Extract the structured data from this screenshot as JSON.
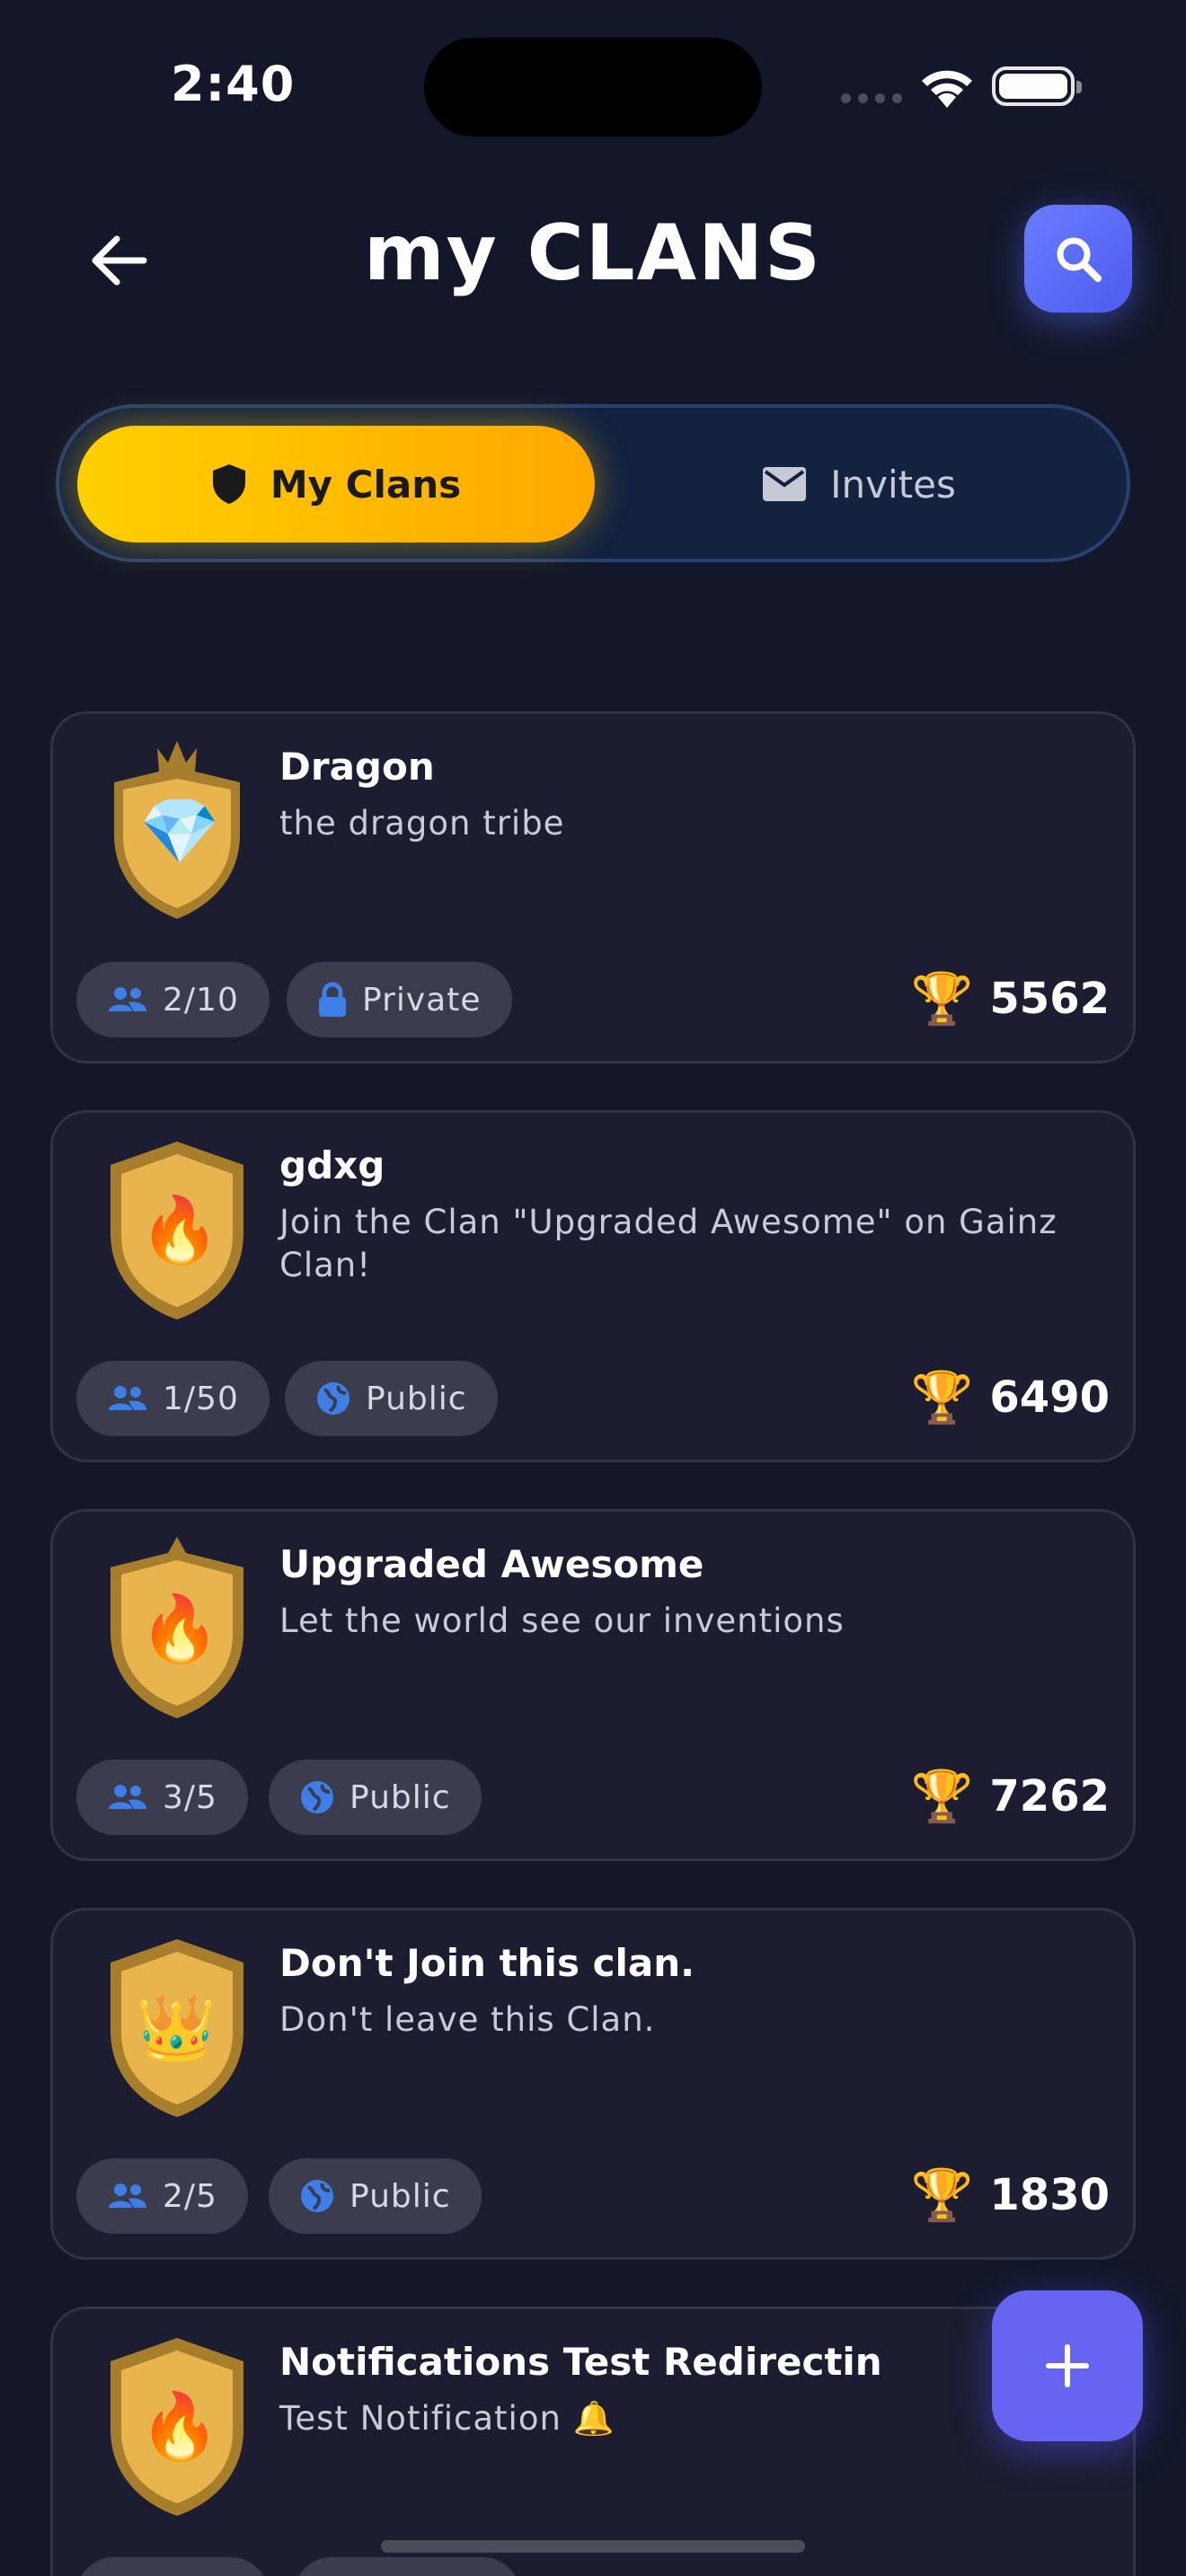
{
  "status_bar": {
    "time": "2:40"
  },
  "header": {
    "title": "my CLANS",
    "back_icon": "arrow-left-icon",
    "search_icon": "search-icon"
  },
  "tabs": [
    {
      "label": "My Clans",
      "icon": "shield-icon",
      "active": true
    },
    {
      "label": "Invites",
      "icon": "mail-icon",
      "active": false
    }
  ],
  "clans": [
    {
      "name": "Dragon",
      "description": "the dragon tribe",
      "members": "2/10",
      "privacy": "Private",
      "privacy_icon": "lock-icon",
      "trophies": "5562",
      "emblem": "💎"
    },
    {
      "name": "gdxg",
      "description": "Join the Clan \"Upgraded Awesome\" on Gainz Clan!",
      "members": "1/50",
      "privacy": "Public",
      "privacy_icon": "globe-icon",
      "trophies": "6490",
      "emblem": "🔥"
    },
    {
      "name": "Upgraded Awesome",
      "description": "Let the world see our inventions",
      "members": "3/5",
      "privacy": "Public",
      "privacy_icon": "globe-icon",
      "trophies": "7262",
      "emblem": "🔥"
    },
    {
      "name": "Don't Join this clan.",
      "description": "Don't leave this Clan.",
      "members": "2/5",
      "privacy": "Public",
      "privacy_icon": "globe-icon",
      "trophies": "1830",
      "emblem": "👑"
    },
    {
      "name": "Notifications Test Redirectin",
      "description": "Test Notification 🔔",
      "members": "",
      "privacy": "",
      "privacy_icon": "globe-icon",
      "trophies": "",
      "emblem": "🔥"
    }
  ],
  "fab": {
    "icon": "plus-icon"
  },
  "colors": {
    "background": "#131729",
    "card": "#1c1d30",
    "accent_yellow": "#ffc400",
    "accent_blue": "#5b6cf5",
    "pill_icon_blue": "#3d7fe6"
  }
}
